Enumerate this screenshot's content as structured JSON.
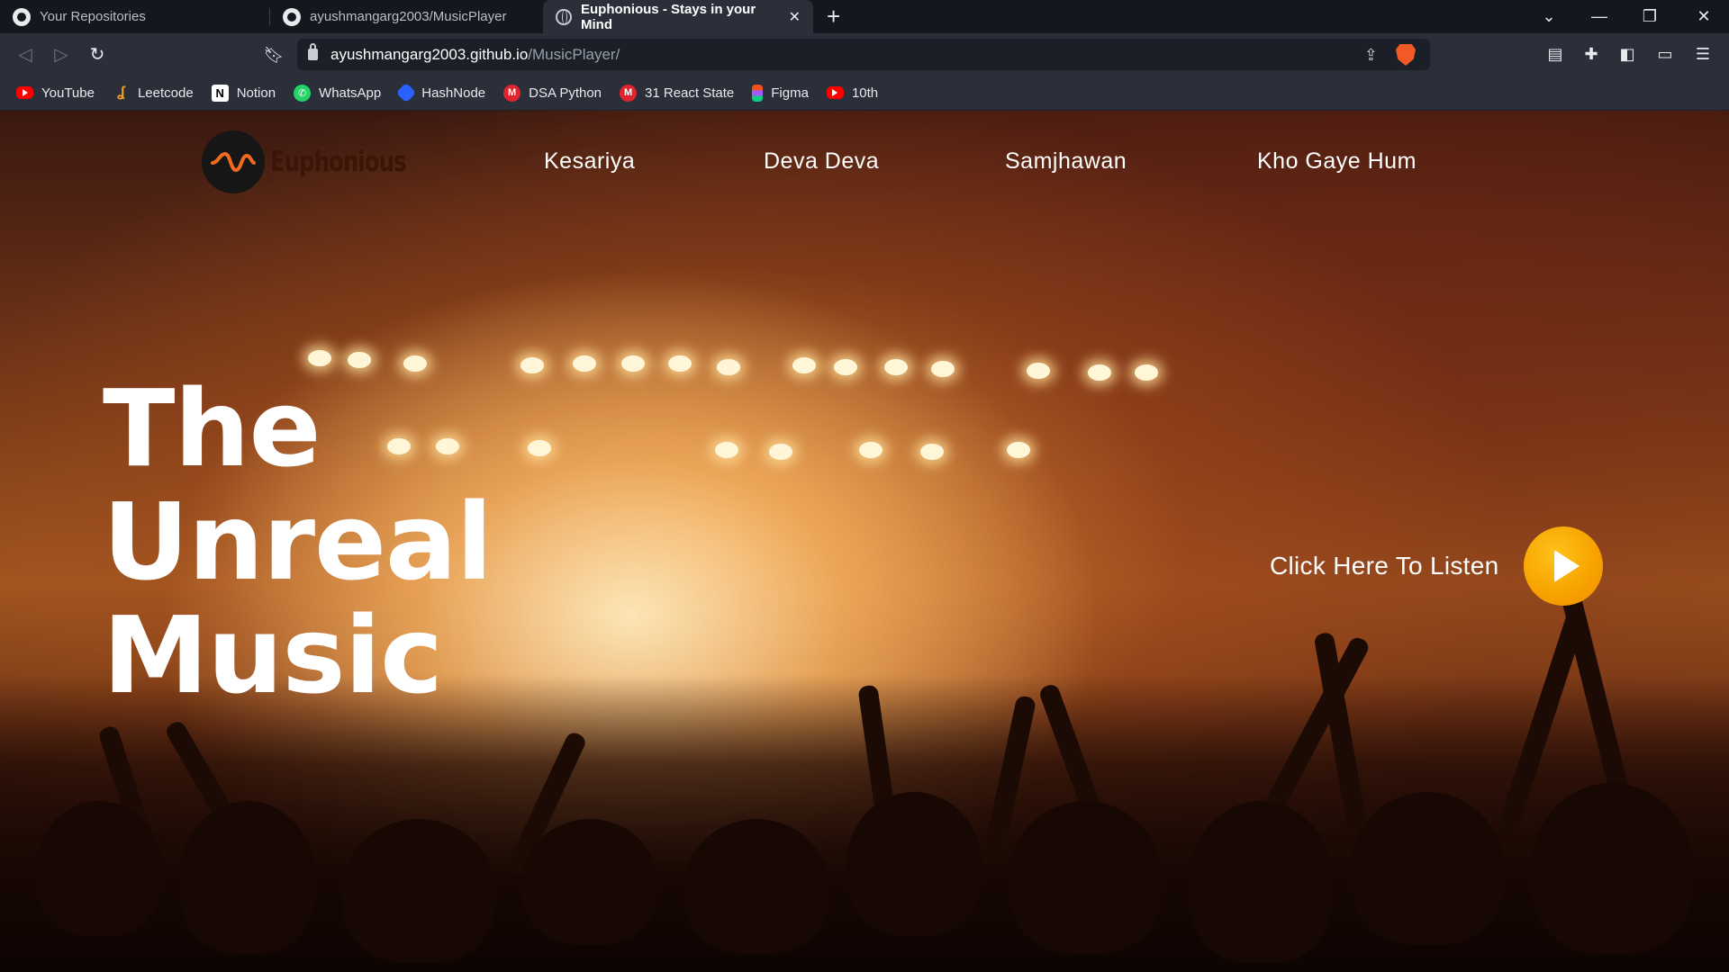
{
  "browser": {
    "tabs": [
      {
        "title": "Your Repositories"
      },
      {
        "title": "ayushmangarg2003/MusicPlayer"
      },
      {
        "title": "Euphonious - Stays in your Mind"
      }
    ],
    "url_host": "ayushmangarg2003.github.io",
    "url_path": "/MusicPlayer/",
    "bookmarks": [
      {
        "label": "YouTube",
        "icon": "youtube-icon"
      },
      {
        "label": "Leetcode",
        "icon": "leetcode-icon"
      },
      {
        "label": "Notion",
        "icon": "notion-icon"
      },
      {
        "label": "WhatsApp",
        "icon": "whatsapp-icon"
      },
      {
        "label": "HashNode",
        "icon": "hashnode-icon"
      },
      {
        "label": "DSA Python",
        "icon": "gmail-icon"
      },
      {
        "label": "31 React State",
        "icon": "gmail-icon"
      },
      {
        "label": "Figma",
        "icon": "figma-icon"
      },
      {
        "label": "10th",
        "icon": "youtube-icon"
      }
    ]
  },
  "page": {
    "logo_text": "Euphonious",
    "nav": [
      "Kesariya",
      "Deva Deva",
      "Samjhawan",
      "Kho Gaye Hum"
    ],
    "hero": [
      "The",
      "Unreal",
      "Music"
    ],
    "cta_label": "Click Here To Listen",
    "accent_color": "#f7a100"
  }
}
